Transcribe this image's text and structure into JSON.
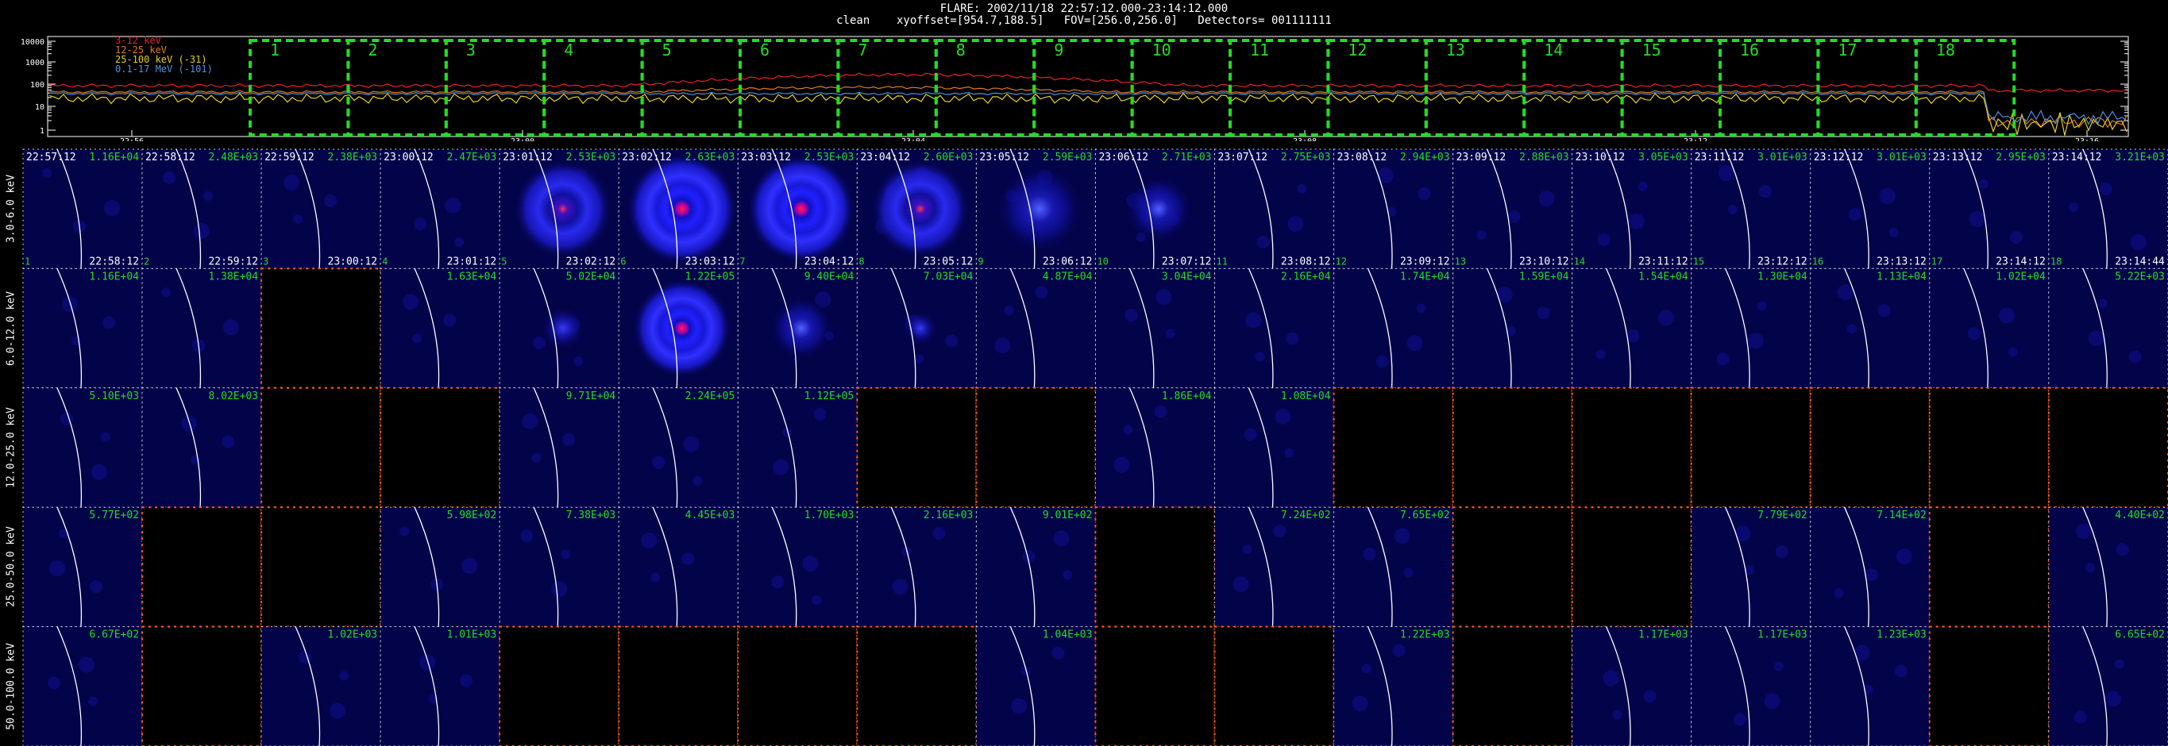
{
  "header": {
    "title": "FLARE: 2002/11/18 22:57:12.000-23:14:12.000",
    "subtitle": "clean    xyoffset=[954.7,188.5]   FOV=[256.0,256.0]   Detectors= 001111111"
  },
  "lightcurve": {
    "y_ticks": [
      "10000",
      "1000",
      "100",
      "10",
      "1"
    ],
    "x_ticks": [
      "22:56",
      "23:00",
      "23:04",
      "23:08",
      "23:12",
      "23:16"
    ],
    "legend": [
      {
        "label": "3-12 keV",
        "color": "#e8202a"
      },
      {
        "label": "12-25 keV",
        "color": "#e07a1e"
      },
      {
        "label": "25-100 keV (-31)",
        "color": "#e8d020"
      },
      {
        "label": "0.1-17 MeV (-101)",
        "color": "#4d8fe0"
      }
    ],
    "intervals": [
      "1",
      "2",
      "3",
      "4",
      "5",
      "6",
      "7",
      "8",
      "9",
      "10",
      "11",
      "12",
      "13",
      "14",
      "15",
      "16",
      "17",
      "18"
    ],
    "interval_color": "#22dd22"
  },
  "grid": {
    "row_labels": [
      "3.0-6.0 keV",
      "6.0-12.0 keV",
      "12.0-25.0 keV",
      "25.0-50.0 keV",
      "50.0-100.0 keV"
    ],
    "start_times": [
      "22:57:12",
      "22:58:12",
      "22:59:12",
      "23:00:12",
      "23:01:12",
      "23:02:12",
      "23:03:12",
      "23:04:12",
      "23:05:12",
      "23:06:12",
      "23:07:12",
      "23:08:12",
      "23:09:12",
      "23:10:12",
      "23:11:12",
      "23:12:12",
      "23:13:12",
      "23:14:12"
    ],
    "end_times": [
      "22:58:12",
      "22:59:12",
      "23:00:12",
      "23:01:12",
      "23:02:12",
      "23:03:12",
      "23:04:12",
      "23:05:12",
      "23:06:12",
      "23:07:12",
      "23:08:12",
      "23:09:12",
      "23:10:12",
      "23:11:12",
      "23:12:12",
      "23:13:12",
      "23:14:12",
      "23:14:44"
    ],
    "values": [
      [
        "1.16E+04",
        "2.48E+03",
        "2.38E+03",
        "2.47E+03",
        "2.53E+03",
        "2.63E+03",
        "2.53E+03",
        "2.60E+03",
        "2.59E+03",
        "2.71E+03",
        "2.75E+03",
        "2.94E+03",
        "2.88E+03",
        "3.05E+03",
        "3.01E+03",
        "3.01E+03",
        "2.95E+03",
        "3.21E+03"
      ],
      [
        "1.16E+04",
        "1.38E+04",
        "",
        "1.63E+04",
        "5.02E+04",
        "1.22E+05",
        "9.40E+04",
        "7.03E+04",
        "4.87E+04",
        "3.04E+04",
        "2.16E+04",
        "1.74E+04",
        "1.59E+04",
        "1.54E+04",
        "1.30E+04",
        "1.13E+04",
        "1.02E+04",
        "5.22E+03"
      ],
      [
        "5.10E+03",
        "8.02E+03",
        "",
        "",
        "9.71E+04",
        "2.24E+05",
        "1.12E+05",
        "",
        "",
        "1.86E+04",
        "1.08E+04",
        "",
        "",
        "",
        "",
        "",
        "",
        ""
      ],
      [
        "5.77E+02",
        "",
        "",
        "5.98E+02",
        "7.38E+03",
        "4.45E+03",
        "1.70E+03",
        "2.16E+03",
        "9.01E+02",
        "",
        "7.24E+02",
        "7.65E+02",
        "",
        "",
        "7.79E+02",
        "7.14E+02",
        "",
        "4.40E+02"
      ],
      [
        "6.67E+02",
        "",
        "1.02E+03",
        "1.01E+03",
        "",
        "",
        "",
        "",
        "1.04E+03",
        "",
        "",
        "1.22E+03",
        "",
        "1.17E+03",
        "1.17E+03",
        "1.23E+03",
        "",
        "6.65E+02"
      ]
    ],
    "value_color": "#22dd22",
    "empty_border_color": "#ff5a1a",
    "image_bg_color": "#03034a",
    "limb_color": "#ffffff"
  }
}
